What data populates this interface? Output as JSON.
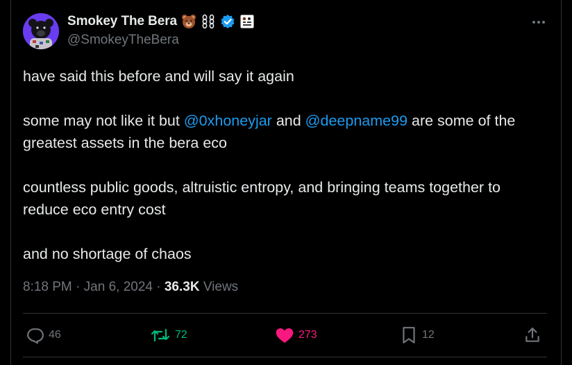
{
  "author": {
    "name": "Smokey The Bera",
    "handle": "@SmokeyTheBera",
    "badges": [
      "bear-emoji-icon",
      "chain-icon",
      "verified-check-icon",
      "affiliate-badge-icon"
    ],
    "verified_color": "#1d9bf0"
  },
  "tweet": {
    "paragraphs": [
      {
        "segments": [
          {
            "text": "have said this before and will say it again"
          }
        ]
      },
      {
        "segments": [
          {
            "text": "some may not like it but "
          },
          {
            "text": "@0xhoneyjar",
            "mention": true
          },
          {
            "text": " and "
          },
          {
            "text": "@deepname99",
            "mention": true
          },
          {
            "text": " are some of the greatest assets in the bera eco"
          }
        ]
      },
      {
        "segments": [
          {
            "text": "countless public goods, altruistic entropy, and bringing teams together to reduce eco entry cost"
          }
        ]
      },
      {
        "segments": [
          {
            "text": "and no shortage of chaos"
          }
        ]
      }
    ]
  },
  "meta": {
    "time": "8:18 PM",
    "separator": "·",
    "date": "Jan 6, 2024",
    "views_count": "36.3K",
    "views_label": "Views"
  },
  "actions": {
    "replies": "46",
    "reposts": "72",
    "likes": "273",
    "bookmarks": "12"
  },
  "colors": {
    "background": "#000000",
    "text": "#e7e9ea",
    "secondary": "#71767b",
    "link": "#1d9bf0",
    "repost_active": "#00ba7c",
    "like_active": "#f91880",
    "border": "#2f3336"
  }
}
